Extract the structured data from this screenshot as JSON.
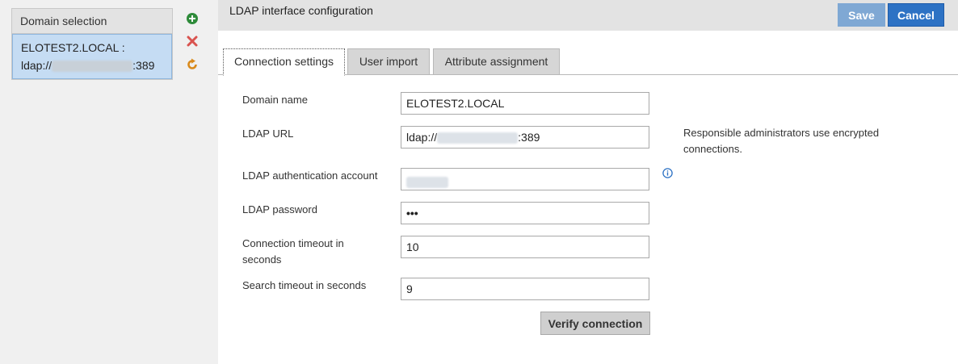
{
  "sidebar": {
    "header": "Domain selection",
    "domain_item": {
      "line1": "ELOTEST2.LOCAL :",
      "prefix": "ldap://",
      "suffix": ":389"
    },
    "add_icon": "add-circle-icon",
    "delete_icon": "x-icon",
    "refresh_icon": "refresh-icon"
  },
  "header": {
    "title": "LDAP interface configuration",
    "save_label": "Save",
    "cancel_label": "Cancel"
  },
  "tabs": [
    {
      "label": "Connection settings",
      "active": true
    },
    {
      "label": "User import",
      "active": false
    },
    {
      "label": "Attribute assignment",
      "active": false
    }
  ],
  "form": {
    "domain_name": {
      "label": "Domain name",
      "value": "ELOTEST2.LOCAL"
    },
    "ldap_url": {
      "label": "LDAP URL",
      "prefix": "ldap://",
      "suffix": ":389"
    },
    "ldap_url_note": "Responsible administrators use encrypted connections.",
    "auth_account": {
      "label": "LDAP authentication account"
    },
    "password": {
      "label": "LDAP password",
      "value": "•••"
    },
    "connection_timeout": {
      "label_line1": "Connection timeout in",
      "label_line2": "seconds",
      "value": "10"
    },
    "search_timeout": {
      "label": "Search timeout in seconds",
      "value": "9"
    },
    "verify_label": "Verify connection"
  },
  "colors": {
    "accent": "#2d72c4",
    "selection": "#c5dcf3",
    "add_green": "#2e8b3a",
    "delete_red": "#d9534f",
    "refresh_orange": "#d98a1c"
  }
}
